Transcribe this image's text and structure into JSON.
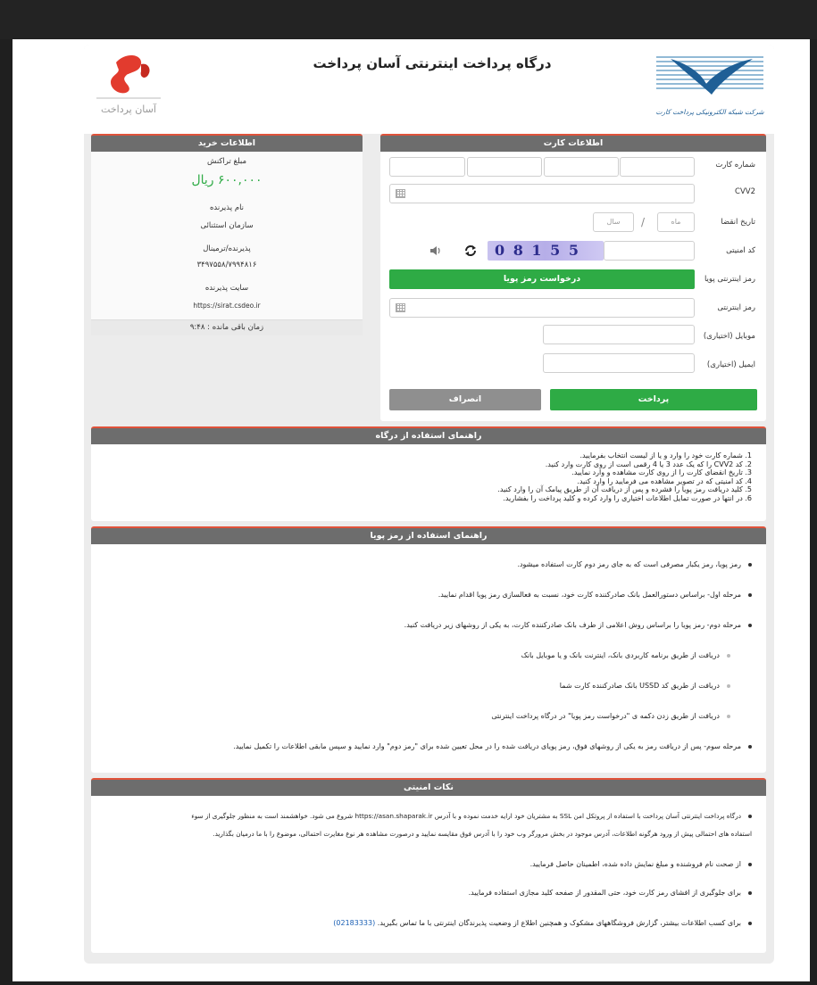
{
  "header": {
    "title": "درگاه پرداخت اینترنتی آسان پرداخت",
    "left_logo_text": "آسان پرداخت",
    "right_logo_text": "شرکت شبکه الکترونیکی پرداخت کارت"
  },
  "card_info": {
    "title": "اطلاعات کارت",
    "card_number_label": "شماره کارت",
    "cvv2_label": "CVV2",
    "expiry_label": "تاریخ انقضا",
    "month_placeholder": "ماه",
    "year_placeholder": "سال",
    "expiry_separator": "/",
    "captcha_label": "کد امنیتی",
    "captcha_text": "0 8 1 5 5",
    "dynamic_pin_label": "رمز اینترنتی پویا",
    "request_otp_button": "درخواست رمز پویا",
    "pin_label": "رمز اینترنتی",
    "mobile_label": "موبایل (اختیاری)",
    "email_label": "ایمیل (اختیاری)",
    "pay_button": "پرداخت",
    "cancel_button": "انصراف"
  },
  "purchase_info": {
    "title": "اطلاعات خرید",
    "amount_label": "مبلغ تراکنش",
    "amount_value": "۶۰۰,۰۰۰ ریال",
    "merchant_label": "نام پذیرنده",
    "merchant_value": "سازمان استثنائی",
    "terminal_label": "پذیرنده/ترمینال",
    "terminal_value": "۳۴۹۷۵۵۸/۷۹۹۴۸۱۶",
    "site_label": "سایت پذیرنده",
    "site_value": "https://sirat.csdeo.ir",
    "time_left": "زمان باقی مانده : ۹:۴۸"
  },
  "gateway_guide": {
    "title": "راهنمای استفاده از درگاه",
    "items": [
      "1. شماره کارت خود را وارد و یا از لیست انتخاب بفرمایید.",
      "2. کد CVV2 را که یک عدد 3 یا 4 رقمی است از روی کارت وارد کنید.",
      "3. تاریخ انقضای کارت را از روی کارت مشاهده و وارد نمایید.",
      "4. کد امنیتی که در تصویر مشاهده می فرمایید را وارد کنید.",
      "5. کلید دریافت رمز پویا را فشرده و پس از دریافت آن از طریق پیامک آن را وارد کنید.",
      "6. در انتها در صورت تمایل اطلاعات اختیاری را وارد کرده و کلید پرداخت را بفشارید."
    ]
  },
  "otp_guide": {
    "title": "راهنمای استفاده از رمز پویا",
    "items": [
      "رمز پویا، رمز یکبار مصرفی است که به جای رمز دوم کارت استفاده میشود.",
      "مرحله اول- براساس دستورالعمل بانک صادرکننده کارت خود، نسبت به فعالسازی رمز پویا اقدام نمایید.",
      "مرحله دوم- رمز پویا را براساس روش اعلامی از طرف بانک صادرکننده کارت، به یکی از روشهای زیر دریافت کنید."
    ],
    "sub_items": [
      "دریافت از طریق برنامه کاربردی بانک، اینترنت بانک و یا موبایل بانک",
      "دریافت از طریق کد USSD بانک صادرکننده کارت شما",
      "دریافت از طریق زدن دکمه ی \"درخواست رمز پویا\" در درگاه پرداخت اینترنتی"
    ],
    "last_item": "مرحله سوم- پس از دریافت رمز به یکی از روشهای فوق، رمز پویای دریافت شده را در محل تعیین شده برای \"رمز دوم\" وارد نمایید و سپس مابقی اطلاعات را تکمیل نمایید."
  },
  "security_tips": {
    "title": "نکات امنیتی",
    "item1_line1": "درگاه پرداخت اینترنتی آسان پرداخت با استفاده از پروتکل امن SSL به مشتریان خود ارایه خدمت نموده و با آدرس https://asan.shaparak.ir شروع می شود. خواهشمند است به منظور جلوگیری از سوء",
    "item1_line2": "استفاده های احتمالی پیش از ورود هرگونه اطلاعات، آدرس موجود در بخش مرورگر وب خود را با آدرس فوق مقایسه نمایید و درصورت مشاهده هر نوع مغایرت احتمالی، موضوع را با ما درمیان بگذارید.",
    "item2": "از صحت نام فروشنده و مبلغ نمایش داده شده، اطمینان حاصل فرمایید.",
    "item3": "برای جلوگیری از افشای رمز کارت خود، حتی المقدور از صفحه کلید مجازی استفاده فرمایید.",
    "item4": "برای کسب اطلاعات بیشتر، گزارش فروشگاههای مشکوک و همچنین اطلاع از وضعیت پذیرندگان اینترنتی با ما تماس بگیرید.",
    "phone": "(02183333)"
  },
  "colors": {
    "accent_red": "#e0523a",
    "green": "#2eab45",
    "gray_header": "#6d6d6d"
  }
}
